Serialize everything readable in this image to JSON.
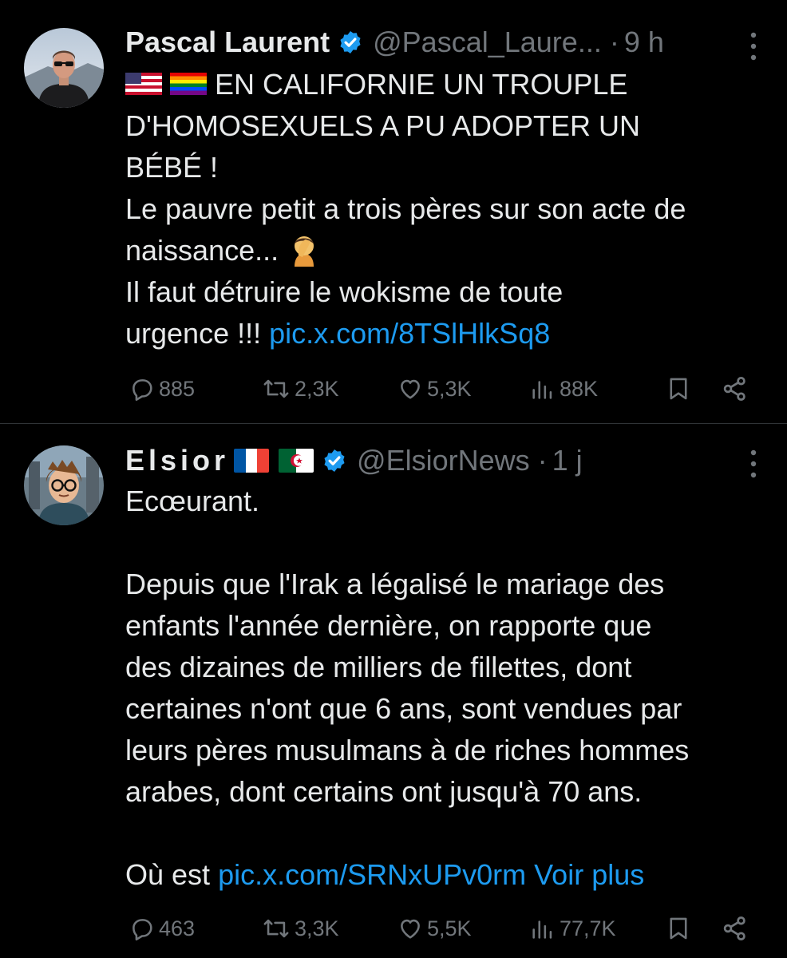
{
  "colors": {
    "background": "#000000",
    "text": "#e7e9ea",
    "secondary": "#71767b",
    "link": "#1d9bf0",
    "divider": "#2f3336",
    "verified": "#1d9bf0"
  },
  "tweets": [
    {
      "display_name": "Pascal Laurent",
      "verified": true,
      "handle": "@Pascal_Laure...",
      "separator": "·",
      "time": "9 h",
      "avatar_icon": "avatar-man-sunglasses",
      "lines": {
        "l1": "EN CALIFORNIE UN TROUPLE",
        "l2": "D'HOMOSEXUELS A PU ADOPTER UN",
        "l3": "BÉBÉ !",
        "l4": "Le pauvre petit a trois pères sur son acte de",
        "l5": "naissance...",
        "l6": "Il faut détruire le wokisme de toute",
        "l7": "urgence !!!",
        "link": "pic.x.com/8TSlHlkSq8"
      },
      "emojis": [
        "us-flag-emoji",
        "rainbow-flag-emoji",
        "facepalm-emoji"
      ],
      "stats": {
        "replies": "885",
        "reposts": "2,3K",
        "likes": "5,3K",
        "views": "88K"
      }
    },
    {
      "display_name": "Elsior",
      "verified": true,
      "handle": "@ElsiorNews",
      "separator": "·",
      "time": "1 j",
      "avatar_icon": "avatar-cartoon-glasses",
      "lines": {
        "l1": "Ecœurant.",
        "l2": "Depuis que l'Irak a légalisé le mariage des",
        "l3": "enfants l'année dernière, on rapporte que",
        "l4": "des dizaines de milliers de fillettes, dont",
        "l5": "certaines n'ont que 6 ans, sont vendues par",
        "l6": "leurs pères musulmans à de riches hommes",
        "l7": "arabes, dont certains ont jusqu'à 70 ans.",
        "l8": "Où est",
        "link": "pic.x.com/SRNxUPv0rm",
        "more": "Voir plus"
      },
      "emojis": [
        "france-flag-emoji",
        "algeria-flag-emoji"
      ],
      "stats": {
        "replies": "463",
        "reposts": "3,3K",
        "likes": "5,5K",
        "views": "77,7K"
      }
    }
  ]
}
